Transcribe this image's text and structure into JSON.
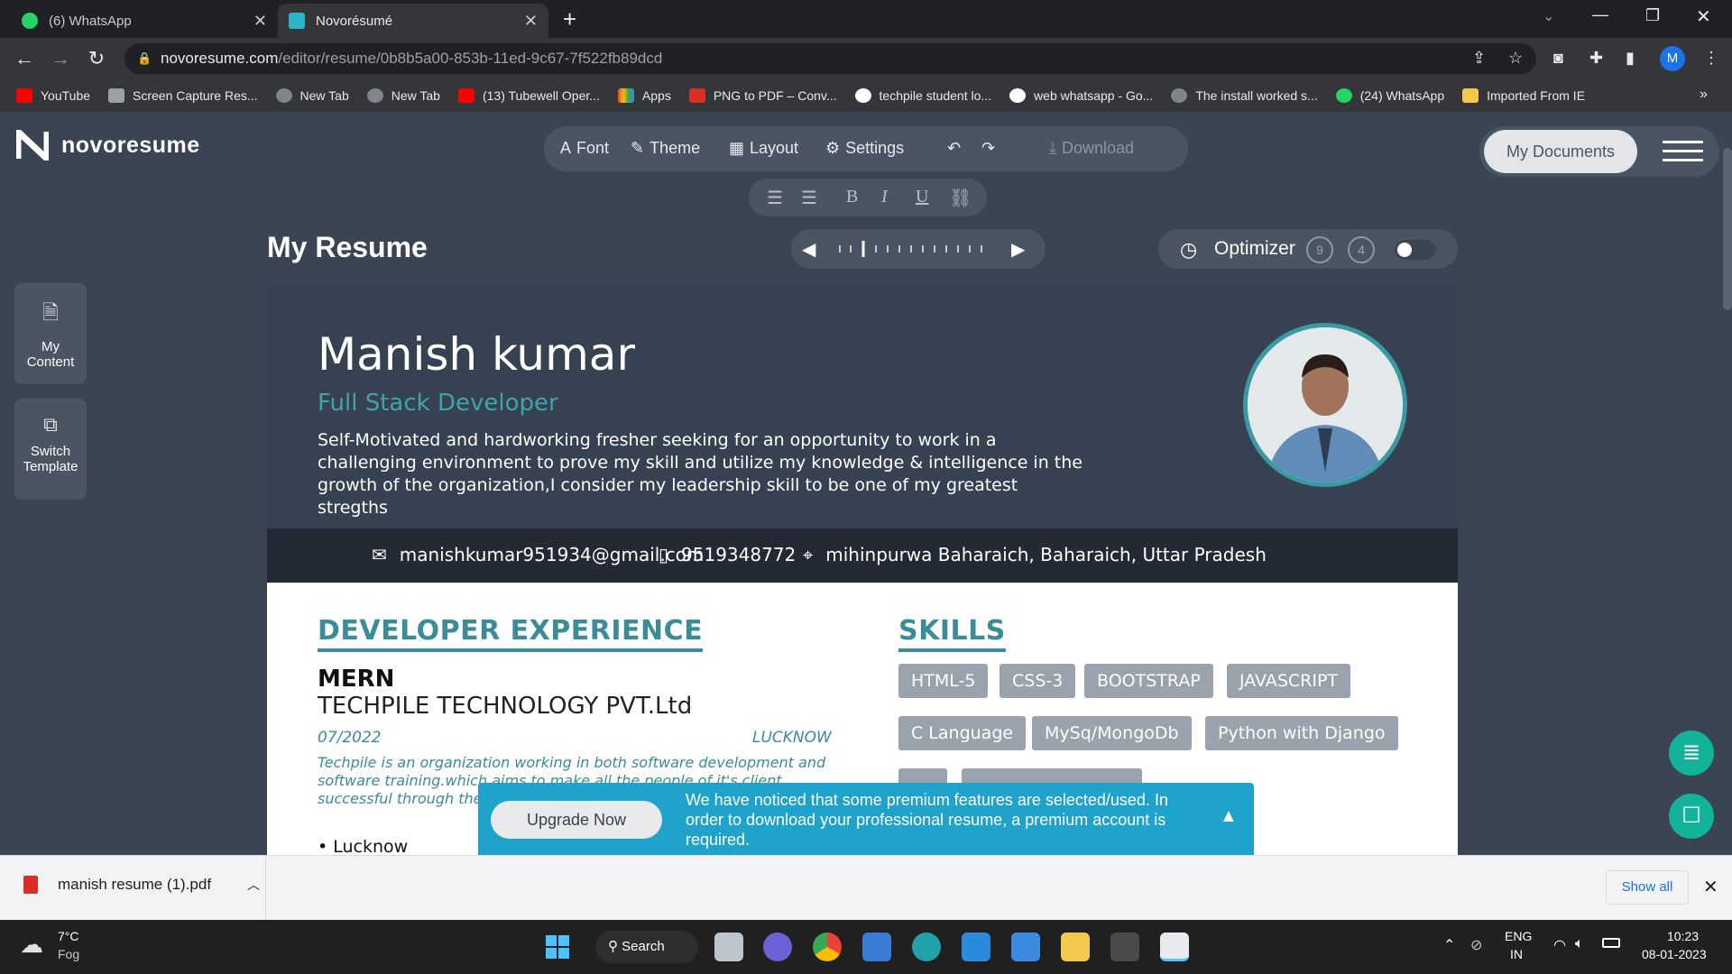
{
  "browser": {
    "tabs": [
      {
        "label": "(6) WhatsApp",
        "active": false
      },
      {
        "label": "Novorésumé",
        "active": true
      }
    ],
    "new_tab": "+",
    "url_host": "novoresume.com",
    "url_path": "/editor/resume/0b8b5a00-853b-11ed-9c67-7f522fb89dcd",
    "profile_initial": "M",
    "bookmarks": [
      "YouTube",
      "Screen Capture Res...",
      "New Tab",
      "New Tab",
      "(13) Tubewell Oper...",
      "Apps",
      "PNG to PDF – Conv...",
      "techpile student lo...",
      "web whatsapp - Go...",
      "The install worked s...",
      "(24) WhatsApp",
      "Imported From IE"
    ],
    "more": "»"
  },
  "app": {
    "brand": "novoresume",
    "toolbar": {
      "font": "Font",
      "theme": "Theme",
      "layout": "Layout",
      "settings": "Settings",
      "download": "Download"
    },
    "format": {
      "bold": "B",
      "italic": "I",
      "underline": "U"
    },
    "my_documents": "My Documents",
    "page_title": "My Resume",
    "optimizer": {
      "label": "Optimizer",
      "count_a": "9",
      "count_b": "4"
    },
    "sidebar": [
      {
        "label_1": "My",
        "label_2": "Content"
      },
      {
        "label_1": "Switch",
        "label_2": "Template"
      }
    ]
  },
  "resume": {
    "name": "Manish kumar",
    "role": "Full Stack Developer",
    "summary": "Self-Motivated and hardworking fresher seeking for an opportunity to work in a challenging environment to prove my skill and utilize my knowledge & intelligence in the growth of the organization,I consider my leadership skill to be one of my greatest stregths",
    "email": "manishkumar951934@gmail.com",
    "phone": "9519348772",
    "location": "mihinpurwa Baharaich, Baharaich, Uttar Pradesh",
    "experience_heading": "DEVELOPER EXPERIENCE",
    "job_title": "MERN",
    "company": "TECHPILE TECHNOLOGY PVT.Ltd",
    "date": "07/2022",
    "job_location": "LUCKNOW",
    "description": "Techpile is an organization working in both software development and software training.which aims to make all the people of it's client successful through the competent to work with",
    "bullet": "Lucknow",
    "skills_heading": "SKILLS",
    "skills": [
      "HTML-5",
      "CSS-3",
      "BOOTSTRAP",
      "JAVASCRIPT",
      "C Language",
      "MySq/MongoDb",
      "Python with Django"
    ]
  },
  "banner": {
    "button": "Upgrade Now",
    "text": "We have noticed that some premium features are selected/used. In order to download your professional resume, a premium account is required."
  },
  "downloads": {
    "file": "manish resume (1).pdf",
    "show_all": "Show all"
  },
  "taskbar": {
    "weather_temp": "7°C",
    "weather_desc": "Fog",
    "search": "Search",
    "lang_1": "ENG",
    "lang_2": "IN",
    "time": "10:23",
    "date": "08-01-2023"
  },
  "colors": {
    "accent": "#3a8c97",
    "header_bg": "#364252",
    "banner": "#1fa3cb"
  }
}
